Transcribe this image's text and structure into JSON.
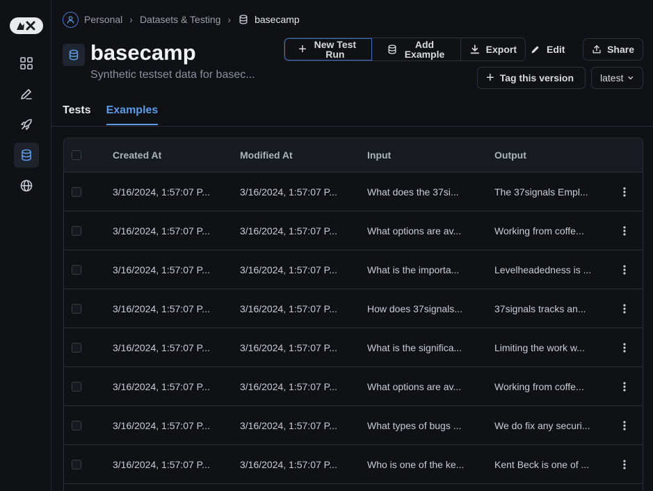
{
  "sidebar": {
    "items": [
      {
        "name": "grid-icon"
      },
      {
        "name": "pencil-icon"
      },
      {
        "name": "rocket-icon"
      },
      {
        "name": "database-icon",
        "active": true
      },
      {
        "name": "globe-icon"
      }
    ]
  },
  "breadcrumb": {
    "items": [
      "Personal",
      "Datasets & Testing",
      "basecamp"
    ]
  },
  "header": {
    "title": "basecamp",
    "subtitle": "Synthetic testset data for basec..."
  },
  "toolbar": {
    "new_test_run": "New Test Run",
    "add_example": "Add Example",
    "export": "Export",
    "edit": "Edit",
    "share": "Share",
    "tag_version": "Tag this version",
    "version_select": "latest"
  },
  "tabs": [
    {
      "label": "Tests",
      "active": false
    },
    {
      "label": "Examples",
      "active": true
    }
  ],
  "table": {
    "columns": [
      "Created At",
      "Modified At",
      "Input",
      "Output"
    ],
    "rows": [
      {
        "created": "3/16/2024, 1:57:07 P...",
        "modified": "3/16/2024, 1:57:07 P...",
        "input": "What does the 37si...",
        "output": "The 37signals Empl..."
      },
      {
        "created": "3/16/2024, 1:57:07 P...",
        "modified": "3/16/2024, 1:57:07 P...",
        "input": "What options are av...",
        "output": "Working from coffe..."
      },
      {
        "created": "3/16/2024, 1:57:07 P...",
        "modified": "3/16/2024, 1:57:07 P...",
        "input": "What is the importa...",
        "output": "Levelheadedness is ..."
      },
      {
        "created": "3/16/2024, 1:57:07 P...",
        "modified": "3/16/2024, 1:57:07 P...",
        "input": "How does 37signals...",
        "output": "37signals tracks an..."
      },
      {
        "created": "3/16/2024, 1:57:07 P...",
        "modified": "3/16/2024, 1:57:07 P...",
        "input": "What is the significa...",
        "output": "Limiting the work w..."
      },
      {
        "created": "3/16/2024, 1:57:07 P...",
        "modified": "3/16/2024, 1:57:07 P...",
        "input": "What options are av...",
        "output": "Working from coffe..."
      },
      {
        "created": "3/16/2024, 1:57:07 P...",
        "modified": "3/16/2024, 1:57:07 P...",
        "input": "What types of bugs ...",
        "output": "We do fix any securi..."
      },
      {
        "created": "3/16/2024, 1:57:07 P...",
        "modified": "3/16/2024, 1:57:07 P...",
        "input": "Who is one of the ke...",
        "output": "Kent Beck is one of ..."
      }
    ]
  },
  "colors": {
    "background": "#0f1115",
    "accent": "#5b9be8",
    "border": "#2a2e36"
  }
}
